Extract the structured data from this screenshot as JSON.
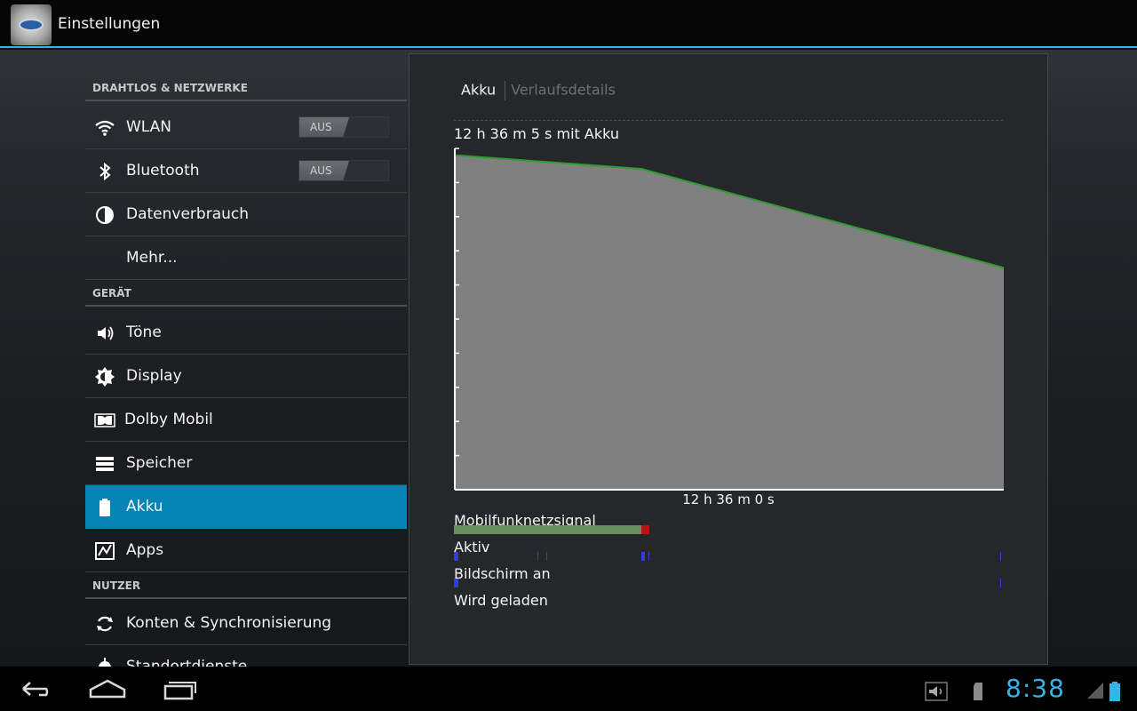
{
  "app": {
    "title": "Einstellungen",
    "icon": "settings-gear-icon"
  },
  "sidebar": {
    "sections": [
      {
        "header": "DRAHTLOS & NETZWERKE"
      },
      {
        "header": "GERÄT"
      },
      {
        "header": "NUTZER"
      }
    ],
    "items": [
      {
        "label": "WLAN",
        "icon": "wifi-icon",
        "toggle": "AUS"
      },
      {
        "label": "Bluetooth",
        "icon": "bluetooth-icon",
        "toggle": "AUS"
      },
      {
        "label": "Datenverbrauch",
        "icon": "data-usage-icon"
      },
      {
        "label": "Mehr...",
        "icon": ""
      },
      {
        "label": "Töne",
        "icon": "speaker-icon"
      },
      {
        "label": "Display",
        "icon": "brightness-icon"
      },
      {
        "label": "Dolby Mobil",
        "icon": "dolby-icon"
      },
      {
        "label": "Speicher",
        "icon": "storage-icon"
      },
      {
        "label": "Akku",
        "icon": "battery-icon",
        "selected": true
      },
      {
        "label": "Apps",
        "icon": "apps-icon"
      },
      {
        "label": "Konten & Synchronisierung",
        "icon": "sync-icon"
      },
      {
        "label": "Standortdienste",
        "icon": "location-icon"
      }
    ]
  },
  "panel": {
    "tabs": [
      {
        "label": "Akku",
        "active": true
      },
      {
        "label": "Verlaufsdetails",
        "active": false
      }
    ],
    "chart_title": "12 h 36 m 5 s mit Akku",
    "chart_xlabel": "12 h 36 m 0 s",
    "tracks": [
      {
        "label": "Mobilfunknetzsignal"
      },
      {
        "label": "Aktiv"
      },
      {
        "label": "Bildschirm an"
      },
      {
        "label": "Wird geladen"
      }
    ]
  },
  "chart_data": {
    "type": "area",
    "title": "12 h 36 m 5 s mit Akku",
    "xlabel": "12 h 36 m 0 s",
    "ylabel": "",
    "x": [
      0,
      0.34,
      1.0
    ],
    "series": [
      {
        "values": [
          98,
          94,
          65
        ]
      }
    ],
    "ylim": [
      0,
      100
    ],
    "grid": false,
    "colors": {
      "fill": "#808080",
      "line": "#2e9c2e",
      "axis": "#ffffff"
    }
  },
  "statusbar": {
    "time": "8:38",
    "icons": [
      "volume-icon",
      "sd-card-icon",
      "signal-icon",
      "battery-status-icon"
    ]
  },
  "navbar": {
    "buttons": [
      "back-button",
      "home-button",
      "recent-apps-button"
    ]
  },
  "colors": {
    "accent": "#33b5e5",
    "selected": "#0583b4"
  }
}
